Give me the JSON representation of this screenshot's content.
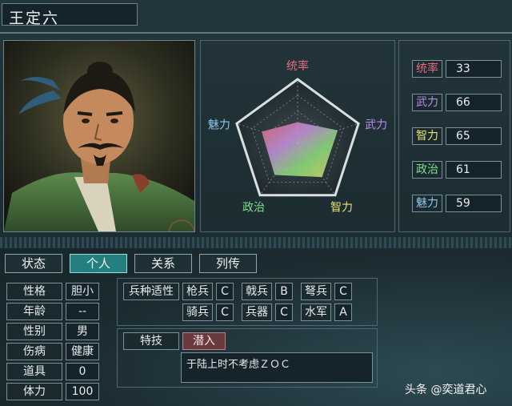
{
  "character": {
    "name": "王定六"
  },
  "radar": {
    "labels": {
      "tongshuai": "统率",
      "wuli": "武力",
      "zhili": "智力",
      "zhengzhi": "政治",
      "meili": "魅力"
    },
    "values": {
      "tongshuai": 33,
      "wuli": 66,
      "zhili": 65,
      "zhengzhi": 61,
      "meili": 59
    },
    "max": 100,
    "colors": {
      "tongshuai": "#e86a7e",
      "wuli": "#b98be8",
      "zhili": "#e8e070",
      "zhengzhi": "#7ee08a",
      "meili": "#8fc6ef"
    }
  },
  "stats": [
    {
      "label": "统率",
      "value": "33",
      "color": "#e86a7e"
    },
    {
      "label": "武力",
      "value": "66",
      "color": "#b98be8"
    },
    {
      "label": "智力",
      "value": "65",
      "color": "#e8e070"
    },
    {
      "label": "政治",
      "value": "61",
      "color": "#7ee08a"
    },
    {
      "label": "魅力",
      "value": "59",
      "color": "#8fc6ef"
    }
  ],
  "tabs": [
    {
      "label": "状态",
      "active": false
    },
    {
      "label": "个人",
      "active": true
    },
    {
      "label": "关系",
      "active": false
    },
    {
      "label": "列传",
      "active": false
    }
  ],
  "info": [
    {
      "label": "性格",
      "value": "胆小"
    },
    {
      "label": "年龄",
      "value": "--"
    },
    {
      "label": "性别",
      "value": "男"
    },
    {
      "label": "伤病",
      "value": "健康"
    },
    {
      "label": "道具",
      "value": "0"
    },
    {
      "label": "体力",
      "value": "100"
    }
  ],
  "troops": {
    "header": "兵种适性",
    "items": [
      {
        "name": "枪兵",
        "grade": "C"
      },
      {
        "name": "戟兵",
        "grade": "B"
      },
      {
        "name": "弩兵",
        "grade": "C"
      },
      {
        "name": "骑兵",
        "grade": "C"
      },
      {
        "name": "兵器",
        "grade": "C"
      },
      {
        "name": "水军",
        "grade": "A"
      }
    ]
  },
  "skill": {
    "header": "特技",
    "name": "潜入",
    "description": "于陆上时不考虑ＺＯＣ"
  },
  "watermark": "头条 @奕道君心"
}
